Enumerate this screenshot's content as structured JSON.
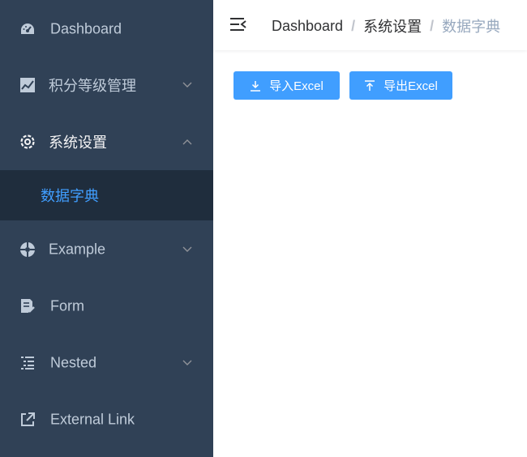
{
  "sidebar": {
    "items": [
      {
        "label": "Dashboard",
        "icon": "dashboard-icon"
      },
      {
        "label": "积分等级管理",
        "icon": "chart-icon"
      },
      {
        "label": "系统设置",
        "icon": "gear-icon"
      },
      {
        "label": "Example",
        "icon": "example-icon"
      },
      {
        "label": "Form",
        "icon": "form-icon"
      },
      {
        "label": "Nested",
        "icon": "nested-icon"
      },
      {
        "label": "External Link",
        "icon": "external-link-icon"
      }
    ],
    "submenu_active": {
      "label": "数据字典"
    }
  },
  "breadcrumb": [
    "Dashboard",
    "系统设置",
    "数据字典"
  ],
  "breadcrumb_separator": "/",
  "actions": {
    "import_label": "导入Excel",
    "export_label": "导出Excel"
  },
  "colors": {
    "sidebar_bg": "#304156",
    "submenu_bg": "#1f2d3d",
    "accent": "#409eff",
    "menu_text": "#bfcbd9"
  }
}
